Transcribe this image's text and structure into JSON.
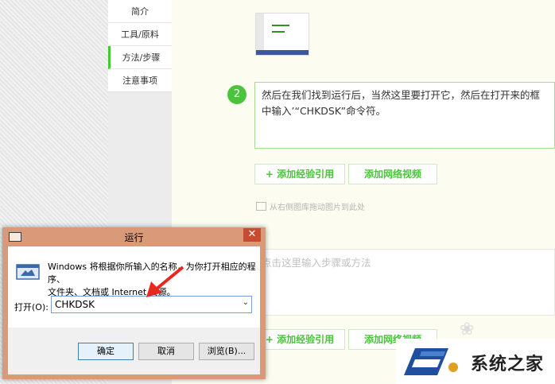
{
  "sidebar": {
    "items": [
      {
        "label": "简介"
      },
      {
        "label": "工具/原料"
      },
      {
        "label": "方法/步骤"
      },
      {
        "label": "注意事项"
      }
    ]
  },
  "step": {
    "number": "2",
    "text": "然后在我们找到运行后，当然这里要打开它，然后在打开来的框中输入’“CHKDSK”命令符。"
  },
  "buttons": {
    "add_experience": "+ 添加经验引用",
    "add_video": "添加网络视频"
  },
  "hint": "从右侧图库拖动图片到此处",
  "step_placeholder": "点击这里输入步骤或方法",
  "watermark": {
    "text": "系统之家"
  },
  "dialog": {
    "title": "运行",
    "description": "Windows 将根据你所输入的名称，为你打开相应的程序、\n文件夹、文档或 Internet 资源。",
    "open_label": "打开(O):",
    "input_value": "CHKDSK",
    "ok": "确定",
    "cancel": "取消",
    "browse": "浏览(B)...",
    "close_glyph": "✕"
  },
  "colors": {
    "accent": "#4bc33c",
    "title_bar": "#d99a7a",
    "close": "#c84b31"
  }
}
